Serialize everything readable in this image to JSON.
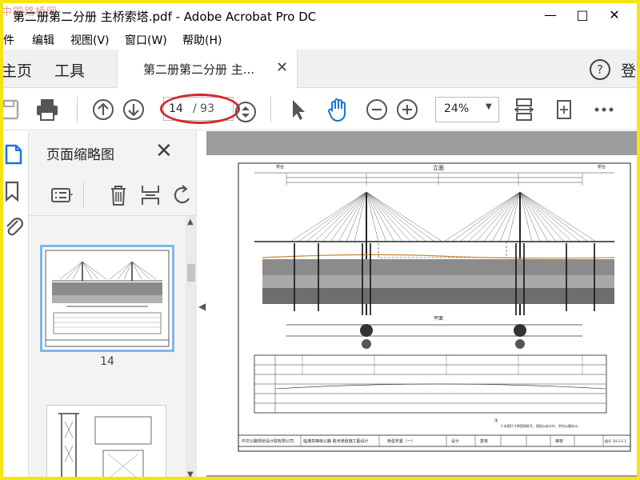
{
  "window": {
    "watermark": "中国路桥网",
    "title": "第二册第二分册 主桥索塔.pdf - Adobe Acrobat Pro DC",
    "controls": [
      "minimize-icon",
      "maximize-icon",
      "close-icon"
    ]
  },
  "menu": [
    {
      "label": "件"
    },
    {
      "label": "编辑"
    },
    {
      "label": "视图(V)"
    },
    {
      "label": "窗口(W)"
    },
    {
      "label": "帮助(H)"
    }
  ],
  "tabs": {
    "home": "主页",
    "tools": "工具",
    "document": "第二册第二分册 主...",
    "close": "✕",
    "help_icon": "question-circle-icon",
    "signin_partial": "登"
  },
  "toolbar": {
    "page_current": "14",
    "page_total": "/ 93",
    "zoom": "24%",
    "icons": [
      "save-icon",
      "print-icon",
      "page-up-icon",
      "page-down-icon",
      "page-nav-icon",
      "select-arrow-icon",
      "hand-icon",
      "zoom-out-icon",
      "zoom-in-icon",
      "fit-page-icon",
      "rotate-page-icon",
      "more-icon"
    ],
    "highlight_color": "#d8242a"
  },
  "thumbnails_panel": {
    "title": "页面缩略图",
    "close": "✕",
    "tools": [
      "thumbnail-options-icon",
      "delete-page-icon",
      "extract-page-icon",
      "rotate-icon"
    ],
    "pages": [
      {
        "label": "14",
        "selected": true
      },
      {
        "label": "",
        "selected": false
      }
    ]
  },
  "drawing": {
    "title_main": "立面",
    "title_plan": "平面",
    "left_note": "桥台",
    "right_note": "桥台",
    "company": "中交公路规划设计院有限公司",
    "project": "临港高等级公路 跨河通道施工图设计",
    "sheet_title": "桥型布置（一）",
    "design": "设计",
    "review": "复核",
    "check": "审核",
    "sheet_no_label": "图号",
    "sheet_no": "S4-2-1-1",
    "notes_head": "注",
    "notes": "1.本图尺寸除里程桩号、高程以米计外，余均以厘米计。"
  }
}
